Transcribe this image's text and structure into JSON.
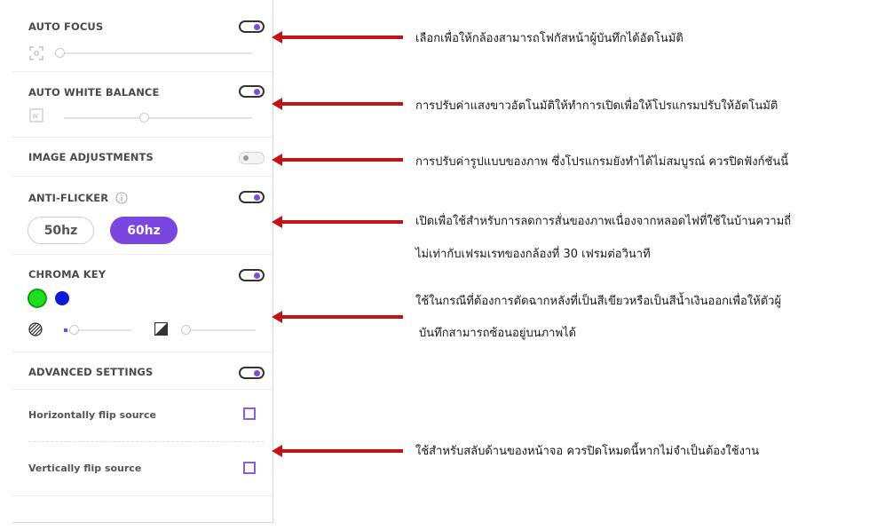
{
  "colors": {
    "accent": "#7b45e0",
    "arrow": "#c0141a",
    "chroma_green": "#1be01b",
    "chroma_blue": "#0a1ad6"
  },
  "auto_focus": {
    "title": "AUTO FOCUS",
    "toggle_on": true,
    "slider_level": 0.0,
    "icon": "focus-frame-icon"
  },
  "auto_white_balance": {
    "title": "AUTO WHITE BALANCE",
    "toggle_on": true,
    "slider_level": 0.42,
    "icon": "white-balance-icon"
  },
  "image_adjustments": {
    "title": "IMAGE ADJUSTMENTS",
    "toggle_on": false
  },
  "anti_flicker": {
    "title": "ANTI-FLICKER",
    "info_icon": "info-icon",
    "toggle_on": true,
    "options": [
      "50hz",
      "60hz"
    ],
    "selected": "60hz"
  },
  "chroma_key": {
    "title": "CHROMA KEY",
    "toggle_on": true,
    "colors": [
      "green",
      "blue"
    ],
    "selected_color": "green",
    "slider1_level": 0.1,
    "slider2_level": 0.0,
    "slider1_icon": "hatched-circle-icon",
    "slider2_icon": "contrast-square-icon"
  },
  "advanced_settings": {
    "title": "ADVANCED SETTINGS",
    "toggle_on": true,
    "options": [
      {
        "label": "Horizontally flip source",
        "checked": false
      },
      {
        "label": "Vertically flip source",
        "checked": false
      }
    ]
  },
  "annotations": [
    "เลือกเพื่อให้กล้องสามารถโฟกัสหน้าผู้บันทึกได้อัตโนมัติ",
    "การปรับค่าแสงขาวอัตโนมัติให้ทำการเปิดเพื่อให้โปรแกรมปรับให้อัตโนมัติ",
    "การปรับค่ารูปแบบของภาพ ซึ่งโปรแกรมยังทำได้ไม่สมบูรณ์ ควรปิดฟังก์ชันนี้",
    "เปิดเพื่อใช้สำหรับการลดการสั่นของภาพเนื่องจากหลอดไฟที่ใช้ในบ้านความถี่",
    "ไม่เท่ากับเฟรมเรทของกล้องที่ 30 เฟรมต่อวินาที",
    "ใช้ในกรณีที่ต้องการตัดฉากหลังที่เป็นสีเขียวหรือเป็นสีน้ำเงินออกเพื่อให้ตัวผู้",
    "บันทึกสามารถซ้อนอยู่บนภาพได้",
    "ใช้สำหรับสลับด้านของหน้าจอ ควรปิดโหมดนี้หากไม่จำเป็นต้องใช้งาน"
  ]
}
